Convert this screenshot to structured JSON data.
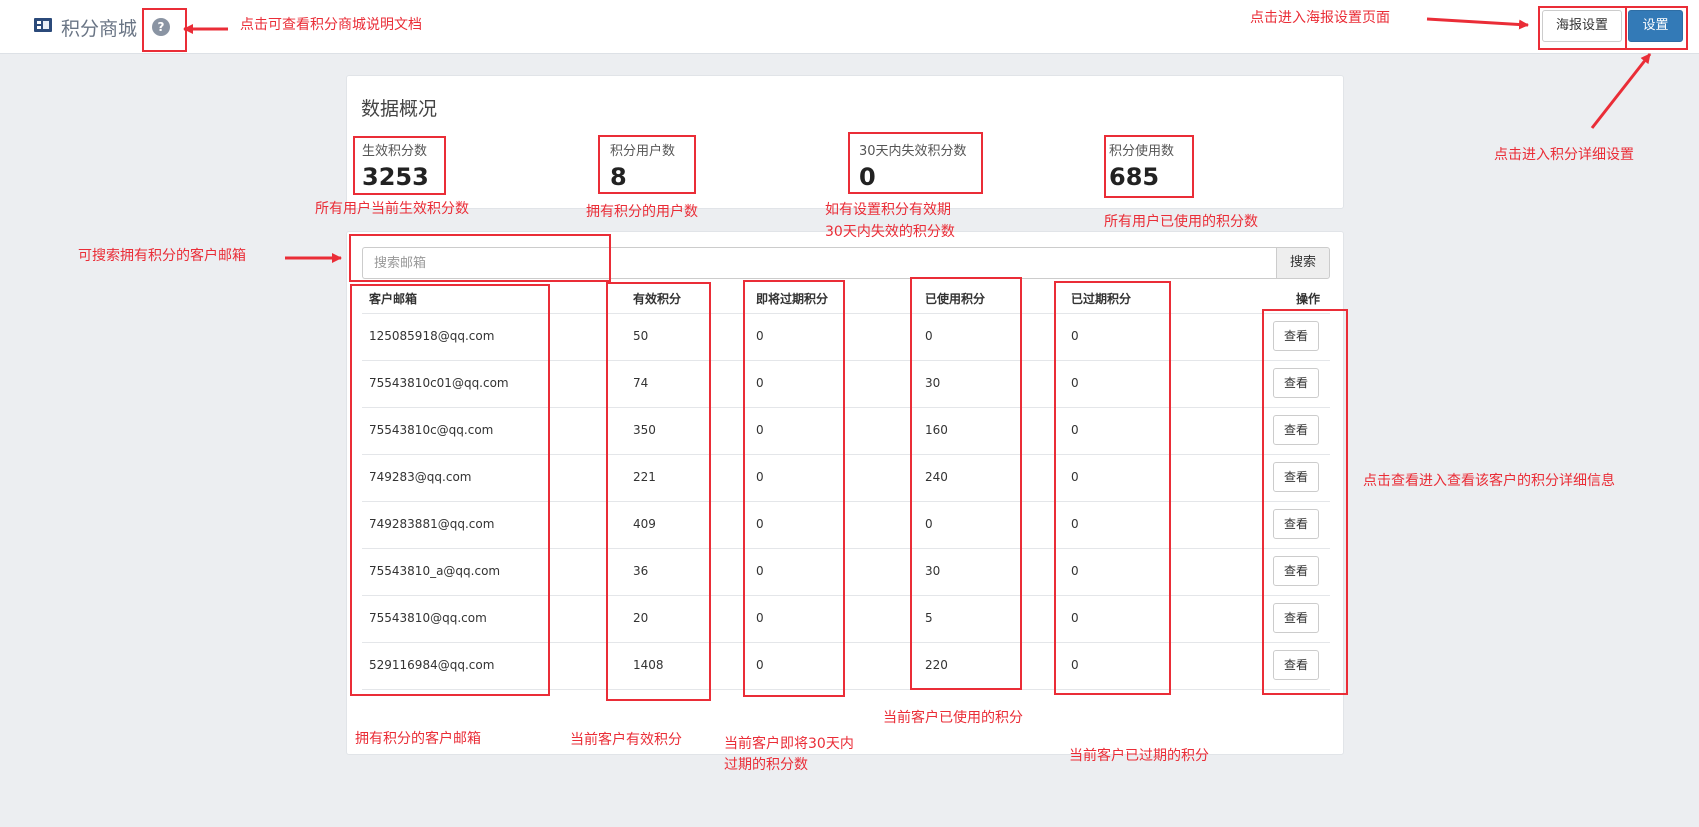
{
  "header": {
    "title": "积分商城",
    "help_icon": "question-circle-icon",
    "app_icon": "mall-icon",
    "poster_button": "海报设置",
    "settings_button": "设置"
  },
  "overview": {
    "heading": "数据概况",
    "stats": [
      {
        "label": "生效积分数",
        "value": "3253"
      },
      {
        "label": "积分用户数",
        "value": "8"
      },
      {
        "label": "30天内失效积分数",
        "value": "0"
      },
      {
        "label": "积分使用数",
        "value": "685"
      }
    ]
  },
  "search": {
    "placeholder": "搜索邮箱",
    "button": "搜索"
  },
  "table": {
    "headers": [
      "客户邮箱",
      "有效积分",
      "即将过期积分",
      "已使用积分",
      "已过期积分",
      "操作"
    ],
    "action_label": "查看",
    "rows": [
      [
        "125085918@qq.com",
        "50",
        "0",
        "0",
        "0"
      ],
      [
        "75543810c01@qq.com",
        "74",
        "0",
        "30",
        "0"
      ],
      [
        "75543810c@qq.com",
        "350",
        "0",
        "160",
        "0"
      ],
      [
        "749283@qq.com",
        "221",
        "0",
        "240",
        "0"
      ],
      [
        "749283881@qq.com",
        "409",
        "0",
        "0",
        "0"
      ],
      [
        "75543810_a@qq.com",
        "36",
        "0",
        "30",
        "0"
      ],
      [
        "75543810@qq.com",
        "20",
        "0",
        "5",
        "0"
      ],
      [
        "529116984@qq.com",
        "1408",
        "0",
        "220",
        "0"
      ]
    ]
  },
  "annotations": {
    "help": "点击可查看积分商城说明文档",
    "poster": "点击进入海报设置页面",
    "settings": "点击进入积分详细设置",
    "stat_effective": "所有用户当前生效积分数",
    "stat_users": "拥有积分的用户数",
    "stat_expiring_1": "如有设置积分有效期",
    "stat_expiring_2": "30天内失效的积分数",
    "stat_used": "所有用户已使用的积分数",
    "search": "可搜索拥有积分的客户邮箱",
    "view": "点击查看进入查看该客户的积分详细信息",
    "col_email": "拥有积分的客户邮箱",
    "col_valid": "当前客户有效积分",
    "col_expiring_1": "当前客户即将30天内",
    "col_expiring_2": "过期的积分数",
    "col_used": "当前客户已使用的积分",
    "col_expired": "当前客户已过期的积分",
    "color": "#ea2d37"
  }
}
